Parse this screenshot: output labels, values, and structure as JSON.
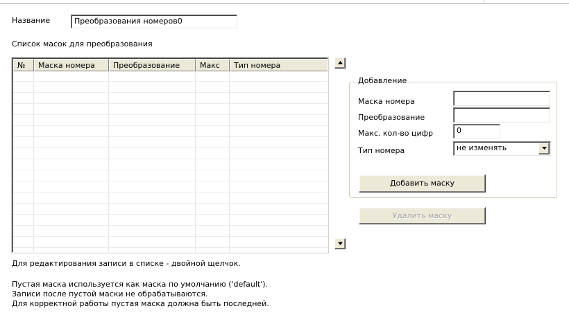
{
  "form": {
    "name_label": "Название",
    "name_value": "Преобразования номеров0",
    "list_label": "Список масок для преобразования"
  },
  "grid": {
    "columns": [
      "№",
      "Маска номера",
      "Преобразование",
      "Макс",
      "Тип номера"
    ],
    "rows": []
  },
  "add_group": {
    "legend": "Добавление",
    "mask_label": "Маска номера",
    "mask_value": "",
    "transform_label": "Преобразование",
    "transform_value": "",
    "maxdigits_label": "Макс. кол-во цифр",
    "maxdigits_value": "0",
    "type_label": "Тип номера",
    "type_value": "не изменять",
    "add_button": "Добавить маску"
  },
  "delete_button": "Удалить маску",
  "notes": {
    "edit_hint": "Для редактирования записи в списке - двойной щелчок.",
    "line1": "Пустая маска используется как маска по умолчанию ('default').",
    "line2": "Записи после пустой маски не обрабатываются.",
    "line3": "Для корректной работы пустая маска должна быть последней."
  },
  "icons": {
    "scroll_up": "arrow-up-icon",
    "scroll_down": "arrow-down-icon",
    "dropdown": "chevron-down-icon"
  }
}
